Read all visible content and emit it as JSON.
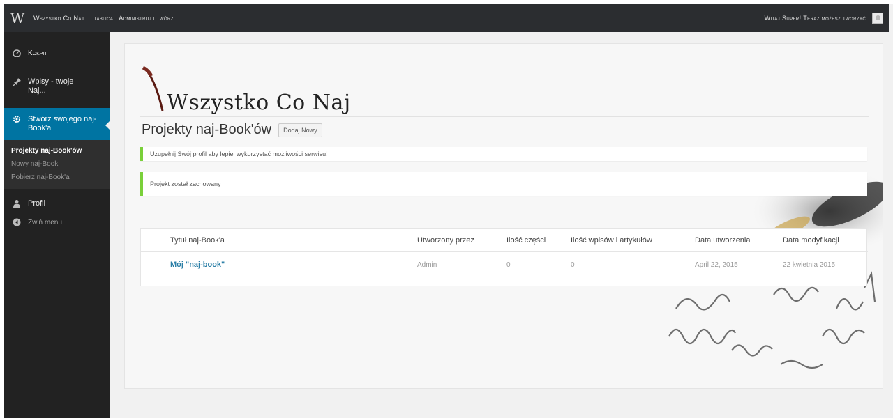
{
  "adminbar": {
    "site_name": "Wszystko Co Naj...",
    "tablica": "tablica",
    "admin_link": "Administruj i twórz",
    "greeting": "Witaj Super! Teraz możesz tworzyć."
  },
  "sidebar": {
    "items": [
      {
        "icon": "dashboard-icon",
        "label": "Kokpit"
      },
      {
        "icon": "pin-icon",
        "label": "Wpisy - twoje Naj..."
      },
      {
        "icon": "gear-icon",
        "label": "Stwórz swojego naj-Book'a"
      },
      {
        "icon": "user-icon",
        "label": "Profil"
      },
      {
        "icon": "collapse-icon",
        "label": "Zwiń menu"
      }
    ],
    "submenu": [
      {
        "label": "Projekty naj-Book'ów",
        "current": true
      },
      {
        "label": "Nowy naj-Book",
        "current": false
      },
      {
        "label": "Pobierz naj-Book'a",
        "current": false
      }
    ]
  },
  "page": {
    "logo_text": "Wszystko Co Naj",
    "title": "Projekty naj-Book'ów",
    "add_new": "Dodaj Nowy"
  },
  "notices": {
    "profile": "Uzupełnij Swój profil aby lepiej wykorzystać możliwości serwisu!",
    "saved": "Projekt został zachowany"
  },
  "table": {
    "headers": [
      "Tytuł naj-Book'a",
      "Utworzony przez",
      "Ilość części",
      "Ilość wpisów i artykułów",
      "Data utworzenia",
      "Data modyfikacji"
    ],
    "rows": [
      [
        "Mój \"naj-book\"",
        "Admin",
        "0",
        "0",
        "April 22, 2015",
        "22 kwietnia 2015"
      ]
    ]
  },
  "colors": {
    "adminbar": "#2b2d30",
    "sidebar": "#222222",
    "active_menu": "#0074a2",
    "notice_border": "#7ad03a",
    "link": "#2a7ea6"
  }
}
